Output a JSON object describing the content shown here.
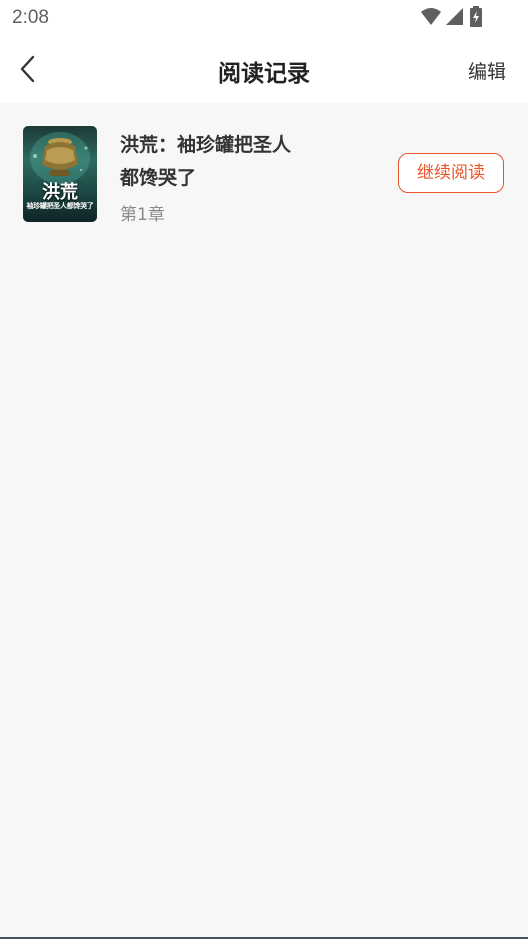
{
  "status_bar": {
    "time": "2:08",
    "icons": [
      "wifi-icon",
      "signal-icon",
      "battery-icon"
    ]
  },
  "nav": {
    "back_icon": "chevron-left-icon",
    "title": "阅读记录",
    "edit_label": "编辑"
  },
  "history": [
    {
      "title": "洪荒：袖珍罐把圣人都馋哭了",
      "title_line1": "洪荒：袖珍罐把圣人",
      "title_line2": "都馋哭了",
      "chapter": "第1章",
      "cover_title": "洪荒",
      "cover_subtitle": "袖珍罐把圣人都馋哭了",
      "continue_label": "继续阅读"
    }
  ],
  "colors": {
    "accent": "#e8552a",
    "background": "#f7f7f7"
  }
}
